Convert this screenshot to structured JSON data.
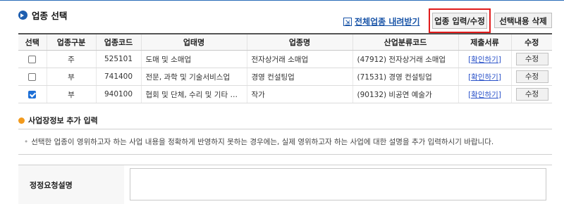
{
  "section": {
    "title": "업종 선택"
  },
  "actions": {
    "download_all": "전체업종 내려받기",
    "input_edit": "업종 입력/수정",
    "delete_selection": "선택내용 삭제"
  },
  "table": {
    "headers": [
      "선택",
      "업종구분",
      "업종코드",
      "업태명",
      "업종명",
      "산업분류코드",
      "제출서류",
      "수정"
    ],
    "rows": [
      {
        "checked": false,
        "type": "주",
        "code": "525101",
        "business": "도매 및 소매업",
        "industry": "전자상거래 소매업",
        "class_code": "(47912) 전자상거래 소매업",
        "doc": "[확인하기]",
        "edit": "수정"
      },
      {
        "checked": false,
        "type": "부",
        "code": "741400",
        "business": "전문, 과학 및 기술서비스업",
        "industry": "경영 컨설팅업",
        "class_code": "(71531) 경영 컨설팅업",
        "doc": "[확인하기]",
        "edit": "수정"
      },
      {
        "checked": true,
        "type": "부",
        "code": "940100",
        "business": "협회 및 단체, 수리 및 기타 …",
        "industry": "작가",
        "class_code": "(90132) 비공연 예술가",
        "doc": "[확인하기]",
        "edit": "수정"
      }
    ]
  },
  "extra": {
    "title": "사업장정보 추가 입력",
    "notice": "선택한 업종이 영위하고자 하는 사업 내용을 정확하게 반영하지 못하는 경우에는, 실제 영위하고자 하는 사업에 대한 설명을 추가 입력하시기 바랍니다.",
    "field_label": "정정요청설명",
    "field_value": ""
  },
  "colors": {
    "accent": "#1f5fb0",
    "highlight_border": "#e01b1b",
    "sub_bullet": "#f29a1d",
    "checkbox": "#1d6fd6"
  },
  "icons": {
    "section_bullet": "arrow-circle-icon",
    "download": "download-icon",
    "sub_bullet": "orange-dot-icon"
  }
}
